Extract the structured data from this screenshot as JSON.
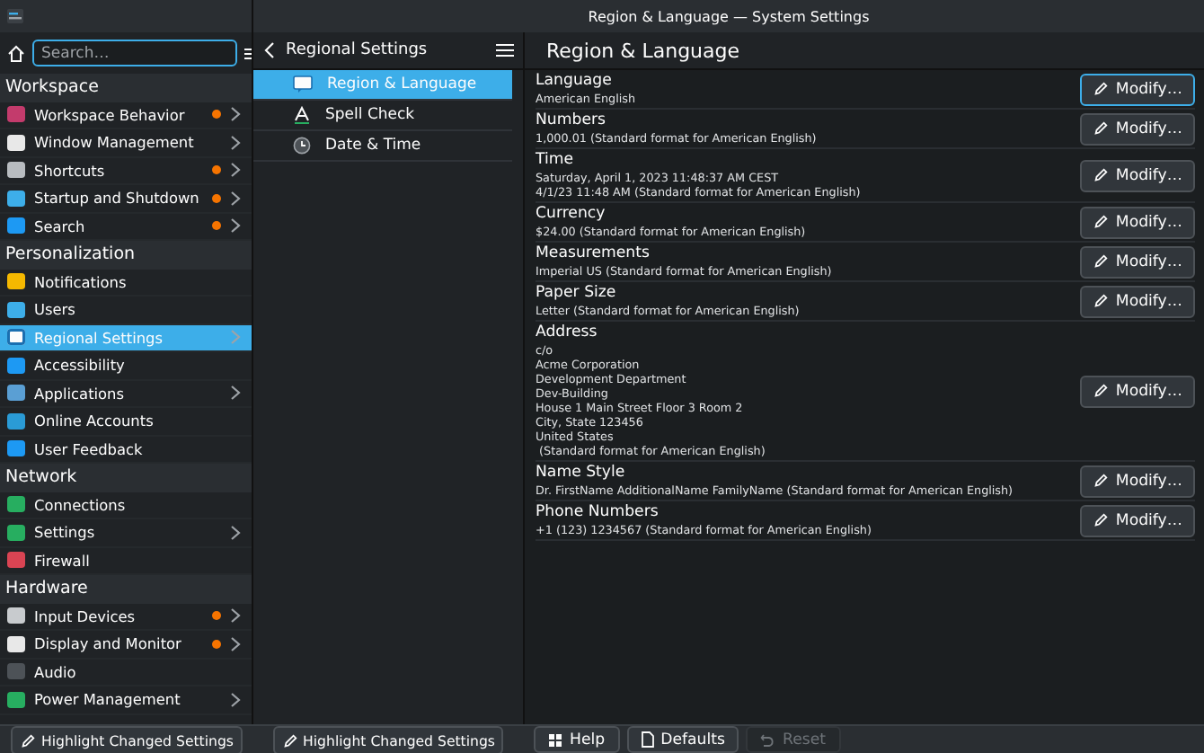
{
  "window": {
    "title": "Region & Language — System Settings"
  },
  "sidebar": {
    "search": {
      "placeholder": "Search…"
    },
    "groups": [
      {
        "header": "Workspace",
        "items": [
          {
            "label": "Workspace Behavior",
            "changed": true,
            "has_children": true,
            "selected": false
          },
          {
            "label": "Window Management",
            "changed": false,
            "has_children": true,
            "selected": false
          },
          {
            "label": "Shortcuts",
            "changed": true,
            "has_children": true,
            "selected": false
          },
          {
            "label": "Startup and Shutdown",
            "changed": true,
            "has_children": true,
            "selected": false
          },
          {
            "label": "Search",
            "changed": true,
            "has_children": true,
            "selected": false
          }
        ]
      },
      {
        "header": "Personalization",
        "items": [
          {
            "label": "Notifications",
            "changed": false,
            "has_children": false,
            "selected": false
          },
          {
            "label": "Users",
            "changed": false,
            "has_children": false,
            "selected": false
          },
          {
            "label": "Regional Settings",
            "changed": false,
            "has_children": true,
            "selected": true
          },
          {
            "label": "Accessibility",
            "changed": false,
            "has_children": false,
            "selected": false
          },
          {
            "label": "Applications",
            "changed": false,
            "has_children": true,
            "selected": false
          },
          {
            "label": "Online Accounts",
            "changed": false,
            "has_children": false,
            "selected": false
          },
          {
            "label": "User Feedback",
            "changed": false,
            "has_children": false,
            "selected": false
          }
        ]
      },
      {
        "header": "Network",
        "items": [
          {
            "label": "Connections",
            "changed": false,
            "has_children": false,
            "selected": false
          },
          {
            "label": "Settings",
            "changed": false,
            "has_children": true,
            "selected": false
          },
          {
            "label": "Firewall",
            "changed": false,
            "has_children": false,
            "selected": false
          }
        ]
      },
      {
        "header": "Hardware",
        "items": [
          {
            "label": "Input Devices",
            "changed": true,
            "has_children": true,
            "selected": false
          },
          {
            "label": "Display and Monitor",
            "changed": true,
            "has_children": true,
            "selected": false
          },
          {
            "label": "Audio",
            "changed": false,
            "has_children": false,
            "selected": false
          },
          {
            "label": "Power Management",
            "changed": false,
            "has_children": true,
            "selected": false
          }
        ]
      }
    ],
    "highlight_button": "Highlight Changed Settings"
  },
  "subpanel": {
    "title": "Regional Settings",
    "items": [
      {
        "label": "Region & Language",
        "selected": true
      },
      {
        "label": "Spell Check",
        "selected": false
      },
      {
        "label": "Date & Time",
        "selected": false
      }
    ],
    "highlight_button": "Highlight Changed Settings"
  },
  "main": {
    "title": "Region & Language",
    "rows": [
      {
        "label": "Language",
        "lines": [
          "American English"
        ],
        "button": "Modify…",
        "focused": true
      },
      {
        "label": "Numbers",
        "lines": [
          "1,000.01 (Standard format for American English)"
        ],
        "button": "Modify…",
        "focused": false
      },
      {
        "label": "Time",
        "lines": [
          "Saturday, April 1, 2023 11:48:37 AM CEST",
          "4/1/23 11:48 AM (Standard format for American English)"
        ],
        "button": "Modify…",
        "focused": false
      },
      {
        "label": "Currency",
        "lines": [
          "$24.00 (Standard format for American English)"
        ],
        "button": "Modify…",
        "focused": false
      },
      {
        "label": "Measurements",
        "lines": [
          "Imperial US (Standard format for American English)"
        ],
        "button": "Modify…",
        "focused": false
      },
      {
        "label": "Paper Size",
        "lines": [
          "Letter (Standard format for American English)"
        ],
        "button": "Modify…",
        "focused": false
      },
      {
        "label": "Address",
        "lines": [
          "c/o",
          "Acme Corporation",
          "Development Department",
          "Dev-Building",
          "House 1 Main Street Floor 3 Room 2",
          "City, State 123456",
          "United States",
          " (Standard format for American English)"
        ],
        "button": "Modify…",
        "focused": false
      },
      {
        "label": "Name Style",
        "lines": [
          "Dr. FirstName AdditionalName FamilyName (Standard format for American English)"
        ],
        "button": "Modify…",
        "focused": false
      },
      {
        "label": "Phone Numbers",
        "lines": [
          "+1 (123) 1234567 (Standard format for American English)"
        ],
        "button": "Modify…",
        "focused": false
      }
    ]
  },
  "footer": {
    "buttons": [
      {
        "kind": "help",
        "label": "Help",
        "disabled": false
      },
      {
        "kind": "defaults",
        "label": "Defaults",
        "disabled": false
      },
      {
        "kind": "reset",
        "label": "Reset",
        "disabled": true
      }
    ]
  }
}
